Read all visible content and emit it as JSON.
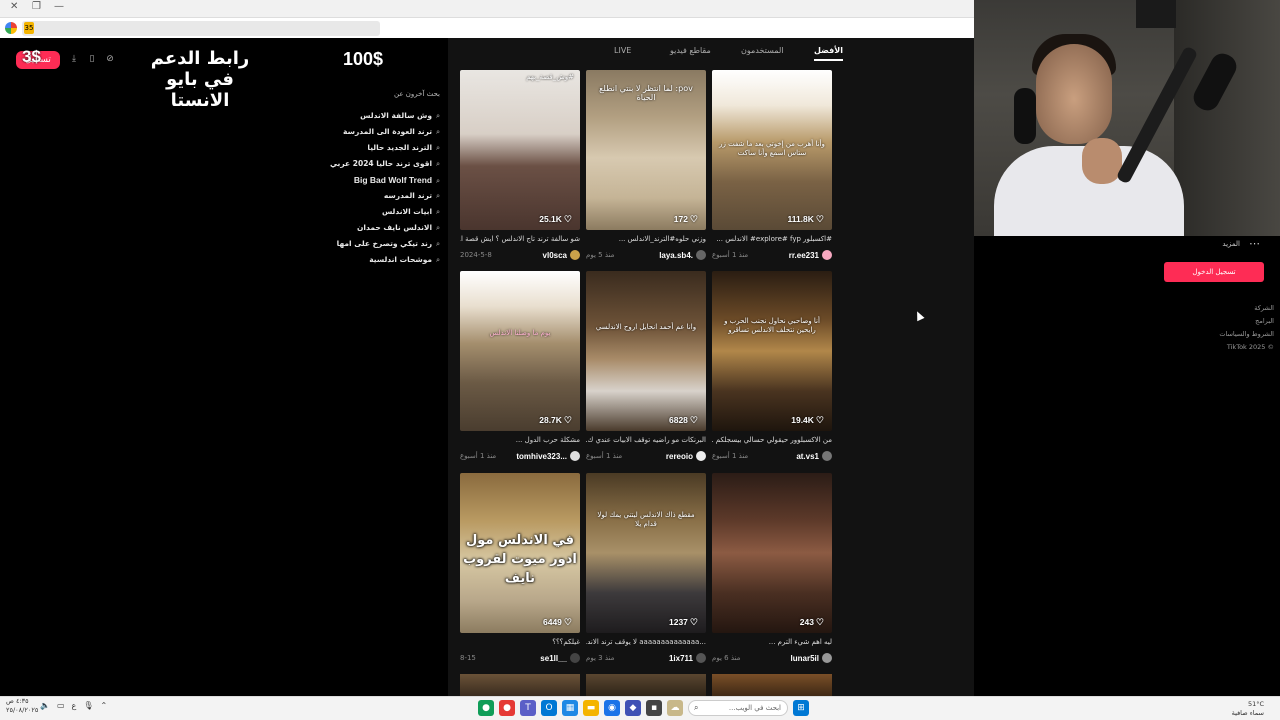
{
  "overlay": {
    "login_label": "تسجيل",
    "price": "3$",
    "support_text": "رابط الدعم في بايو الانستا",
    "goal": "100$"
  },
  "related": {
    "title": "بحث آخرون عن",
    "items": [
      "وش سالفة الاندلس",
      "ترند العودة الى المدرسة",
      "الترند الجديد حاليا",
      "اقوى ترند حاليا 2024 عربي",
      "Big Bad Wolf Trend",
      "ترند المدرسه",
      "ابيات الاندلس",
      "الاندلس نايف حمدان",
      "رند تيكي وتصرخ على امها",
      "موشحات اندلسية"
    ]
  },
  "tabs": {
    "top": "الأفضل",
    "users": "المستخدمون",
    "videos": "مقاطع فيديو",
    "live": "LIVE"
  },
  "videos": [
    {
      "likes": "111.8K",
      "desc": "#اكسبلور explore# fyp# الاندلس ...",
      "user": "rr.ee231",
      "date": "منذ 1 أسبوع",
      "overlay": "وأنا أهرب من إخوتي بعد ما شفت زر ستاس اسمع وأنا ساكت",
      "av": "#f7a8c0"
    },
    {
      "likes": "172",
      "desc": "وزني حلوه#الترند_الاندلس ...",
      "user": "laya.sb4.",
      "date": "منذ 5 يوم",
      "overlay": "pov: لما انتظر لا بنتي انطلع الحياة",
      "av": "#666"
    },
    {
      "likes": "25.1K",
      "desc": "شو سالفة ترند تاج الاندلس ؟ ايش قصة ا...",
      "user": "vl0sca",
      "date": "2024-5-8",
      "overlay": "#وش_قصة_بهم",
      "av": "#c9a14a"
    },
    {
      "likes": "19.4K",
      "desc": "من الاكسبلوور حيقولي حسالي بيسجلكم ...",
      "user": "at.vs1",
      "date": "منذ 1 أسبوع",
      "overlay": "أنا وصاحبي نحاول نجنب الحرب و رايحين نتحلف الاندلس تساقرو",
      "av": "#777"
    },
    {
      "likes": "6828",
      "desc": "البرنكات مو راضيه توقف الابيات عندي ك...",
      "user": "rereoio",
      "date": "منذ 1 أسبوع",
      "overlay": "وانا عم أحمد انحايل اروح الاندلسي",
      "av": "#eee"
    },
    {
      "likes": "28.7K",
      "desc": "مشكلة حرب الدول ...",
      "user": "tomhive323...",
      "date": "منذ 1 أسبوع",
      "overlay": "يوم ما وصلنا الاندلس",
      "av": "#ddd"
    },
    {
      "likes": "243",
      "desc": "ليه اهم شيء الترم ...",
      "user": "lunar5il",
      "date": "منذ 6 يوم",
      "overlay": "",
      "av": "#999"
    },
    {
      "likes": "1237",
      "desc": "...aaaaaaaaaaaaaa لا يوقف ترند الاند...",
      "user": "1ix711",
      "date": "منذ 3 يوم",
      "overlay": "مقطع ذاك الاندلس ليتني يمك لولا قدام يلا",
      "av": "#555"
    },
    {
      "likes": "6449",
      "desc": "غيلكم؟؟؟",
      "user": "se1ll__",
      "date": "8-15",
      "overlay": "في الاندلس مول ادور ميوت لقروب نايف",
      "av": "#444"
    }
  ],
  "right_panel": {
    "more": "المزيد",
    "login": "تسجيل الدخول",
    "links": [
      "الشركة",
      "البرامج",
      "الشروط والسياسات",
      "© TikTok 2025"
    ]
  },
  "taskbar": {
    "search_placeholder": "ابحث في الويب...",
    "weather": "51°C",
    "weather_desc": "سماء صافية",
    "time": "٤:٣٥ ص",
    "date": "٢٥/٠٨/٢٠٢٥"
  }
}
